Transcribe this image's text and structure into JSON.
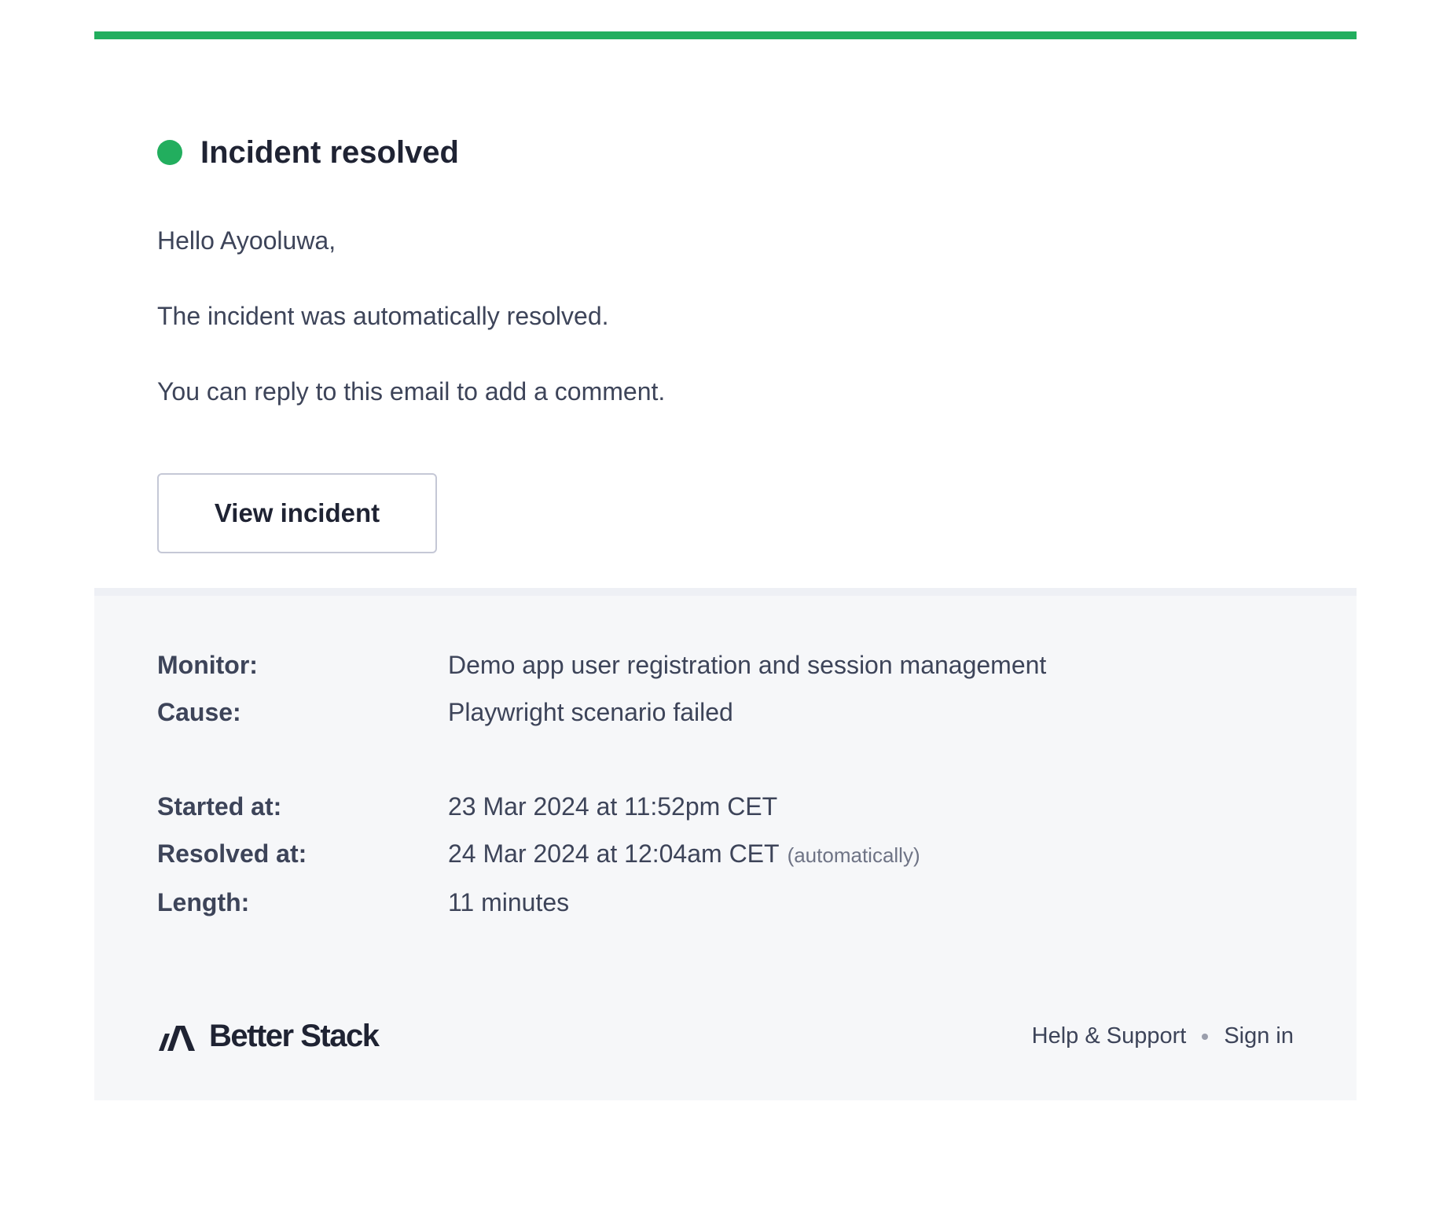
{
  "colors": {
    "accent": "#22ae5e",
    "text": "#3d4459",
    "heading": "#1f2333",
    "details_bg": "#f6f7f9"
  },
  "header": {
    "status_icon": "status-dot-icon",
    "title": "Incident resolved"
  },
  "body": {
    "greeting": "Hello Ayooluwa,",
    "message": "The incident was automatically resolved.",
    "reply_hint": "You can reply to this email to add a comment.",
    "view_button": "View incident"
  },
  "details": {
    "monitor": {
      "label": "Monitor:",
      "value": "Demo app user registration and session management"
    },
    "cause": {
      "label": "Cause:",
      "value": "Playwright scenario failed"
    },
    "started": {
      "label": "Started at:",
      "value": "23 Mar 2024 at 11:52pm CET"
    },
    "resolved": {
      "label": "Resolved at:",
      "value": "24 Mar 2024 at 12:04am CET",
      "note": "(automatically)"
    },
    "length": {
      "label": "Length:",
      "value": "11 minutes"
    }
  },
  "footer": {
    "logo_icon": "better-stack-logo-icon",
    "brand_name": "Better Stack",
    "help_link": "Help & Support",
    "signin_link": "Sign in"
  }
}
